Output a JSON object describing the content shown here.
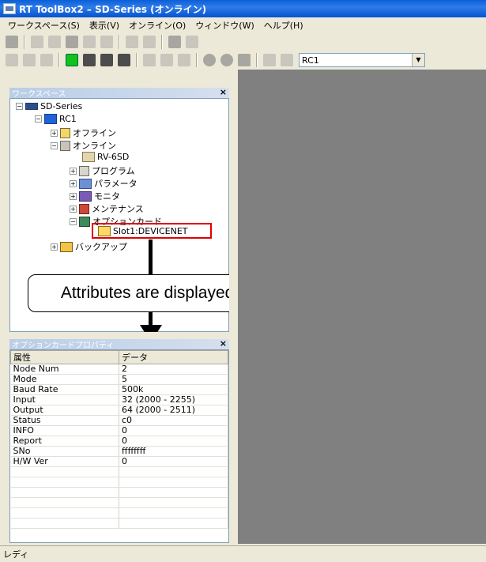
{
  "window": {
    "title": "RT ToolBox2 – SD-Series (オンライン)"
  },
  "menu": [
    "ワークスペース(S)",
    "表示(V)",
    "オンライン(O)",
    "ウィンドウ(W)",
    "ヘルプ(H)"
  ],
  "toolbar": {
    "robot_select": "RC1"
  },
  "workspace": {
    "title": "ワークスペース",
    "tree": {
      "root": "SD-Series",
      "robot": "RC1",
      "offline": "オフライン",
      "online": "オンライン",
      "model": "RV-6SD",
      "program": "プログラム",
      "parameter": "パラメータ",
      "monitor": "モニタ",
      "maintenance": "メンテナンス",
      "option_card": "オプションカード",
      "slot": "Slot1:DEVICENET",
      "backup": "バックアップ"
    }
  },
  "annotation": {
    "text": "Attributes are displayed."
  },
  "properties": {
    "title": "オプションカードプロパティ",
    "col_attr": "属性",
    "col_data": "データ",
    "rows": [
      {
        "k": "Node Num",
        "v": "2"
      },
      {
        "k": "Mode",
        "v": "5"
      },
      {
        "k": "Baud Rate",
        "v": "500k"
      },
      {
        "k": "Input",
        "v": "32 (2000 - 2255)"
      },
      {
        "k": "Output",
        "v": "64 (2000 - 2511)"
      },
      {
        "k": "Status",
        "v": "c0"
      },
      {
        "k": "INFO",
        "v": "0"
      },
      {
        "k": "Report",
        "v": "0"
      },
      {
        "k": "SNo",
        "v": "ffffffff"
      },
      {
        "k": "H/W Ver",
        "v": "0"
      },
      {
        "k": "",
        "v": ""
      },
      {
        "k": "",
        "v": ""
      },
      {
        "k": "",
        "v": ""
      },
      {
        "k": "",
        "v": ""
      },
      {
        "k": "",
        "v": ""
      },
      {
        "k": "",
        "v": ""
      }
    ]
  },
  "status": "レディ"
}
